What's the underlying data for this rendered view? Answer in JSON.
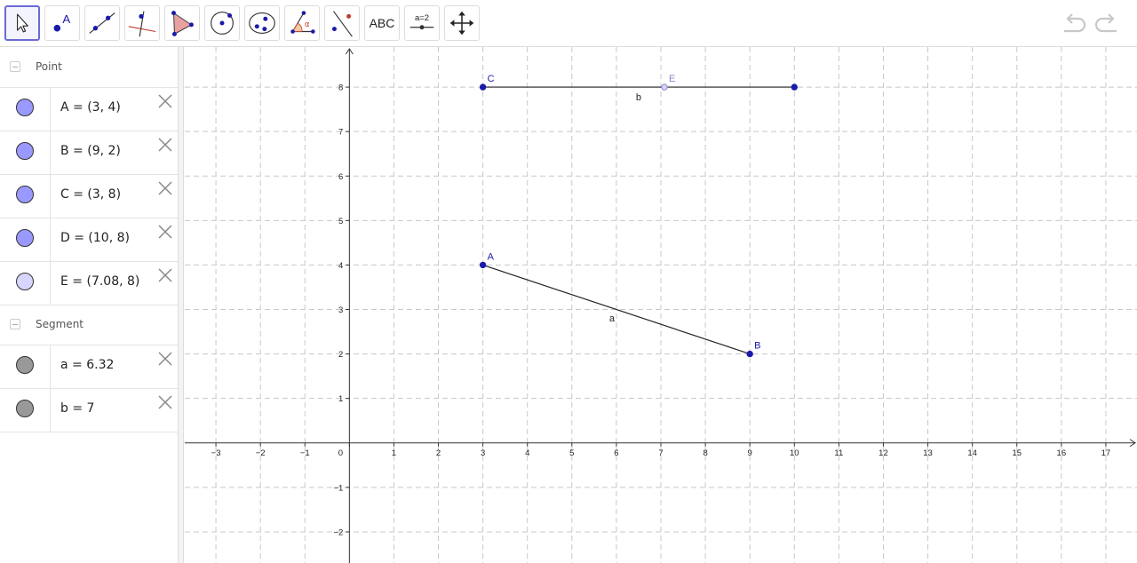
{
  "toolbar": {
    "tools": [
      {
        "name": "move-tool",
        "icon": "arrow-cursor-icon",
        "selected": true
      },
      {
        "name": "point-tool",
        "icon": "point-icon",
        "label": "A"
      },
      {
        "name": "line-tool",
        "icon": "line-icon"
      },
      {
        "name": "perpendicular-tool",
        "icon": "perpendicular-line-icon"
      },
      {
        "name": "polygon-tool",
        "icon": "polygon-icon"
      },
      {
        "name": "circle-tool",
        "icon": "circle-icon"
      },
      {
        "name": "ellipse-tool",
        "icon": "ellipse-icon"
      },
      {
        "name": "angle-tool",
        "icon": "angle-icon",
        "label": "α"
      },
      {
        "name": "reflect-tool",
        "icon": "reflect-icon"
      },
      {
        "name": "text-tool",
        "icon": "text-icon",
        "label": "ABC"
      },
      {
        "name": "slider-tool",
        "icon": "slider-icon",
        "label": "a=2"
      },
      {
        "name": "move-graphics-tool",
        "icon": "move-arrows-icon"
      }
    ],
    "undo_icon": "undo-icon",
    "redo_icon": "redo-icon"
  },
  "algebra": {
    "groups": [
      {
        "name": "Point",
        "items": [
          {
            "label": "A = (3, 4)",
            "color": "#9999ff"
          },
          {
            "label": "B = (9, 2)",
            "color": "#9999ff"
          },
          {
            "label": "C = (3, 8)",
            "color": "#9999ff"
          },
          {
            "label": "D = (10, 8)",
            "color": "#9999ff"
          },
          {
            "label": "E = (7.08, 8)",
            "color": "#d6d6ff"
          }
        ]
      },
      {
        "name": "Segment",
        "items": [
          {
            "label": "a = 6.32",
            "color": "#999999"
          },
          {
            "label": "b = 7",
            "color": "#999999"
          }
        ]
      }
    ]
  },
  "graphics": {
    "xlim": [
      -3.7,
      17.7
    ],
    "ylim": [
      -2.7,
      8.9
    ],
    "x_ticks": [
      -3,
      -2,
      -1,
      0,
      1,
      2,
      3,
      4,
      5,
      6,
      7,
      8,
      9,
      10,
      11,
      12,
      13,
      14,
      15,
      16,
      17
    ],
    "y_ticks": [
      -2,
      -1,
      1,
      2,
      3,
      4,
      5,
      6,
      7,
      8
    ],
    "point_color": "#1a1aaa",
    "light_point_color": "#8888cc",
    "points": [
      {
        "name": "A",
        "x": 3,
        "y": 4,
        "light": false,
        "label_pos": "tr"
      },
      {
        "name": "B",
        "x": 9,
        "y": 2,
        "light": false,
        "label_pos": "tr"
      },
      {
        "name": "C",
        "x": 3,
        "y": 8,
        "light": false,
        "label_pos": "tr"
      },
      {
        "name": "D",
        "x": 10,
        "y": 8,
        "light": false,
        "label_pos": "none"
      },
      {
        "name": "E",
        "x": 7.08,
        "y": 8,
        "light": true,
        "label_pos": "tr"
      }
    ],
    "segments": [
      {
        "name": "a",
        "from": [
          3,
          4
        ],
        "to": [
          9,
          2
        ],
        "label_at": [
          5.9,
          2.73
        ]
      },
      {
        "name": "b",
        "from": [
          3,
          8
        ],
        "to": [
          10,
          8
        ],
        "label_at": [
          6.5,
          7.7
        ]
      }
    ]
  }
}
